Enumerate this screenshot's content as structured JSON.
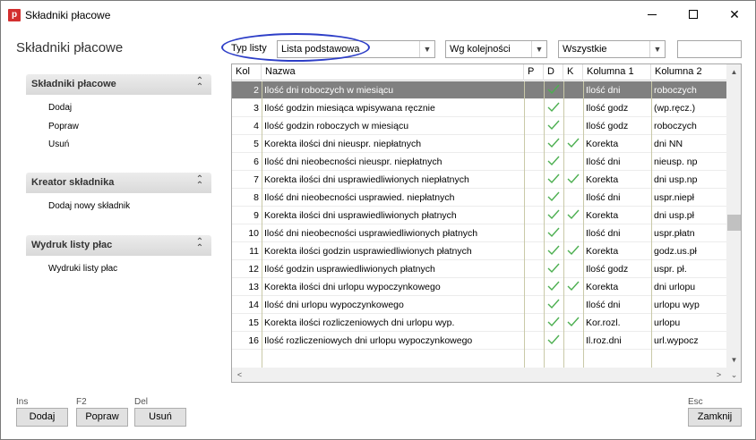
{
  "window": {
    "app_icon_letter": "p",
    "title": "Składniki płacowe"
  },
  "page_title": "Składniki płacowe",
  "sidebar": {
    "panels": [
      {
        "title": "Składniki płacowe",
        "links": [
          "Dodaj",
          "Popraw",
          "Usuń"
        ]
      },
      {
        "title": "Kreator składnika",
        "links": [
          "Dodaj nowy składnik"
        ]
      },
      {
        "title": "Wydruk listy płac",
        "links": [
          "Wydruki listy płac"
        ]
      }
    ]
  },
  "toolbar": {
    "list_type_label": "Typ listy",
    "list_type_value": "Lista podstawowa",
    "order_value": "Wg kolejności",
    "filter_value": "Wszystkie",
    "search_value": ""
  },
  "grid": {
    "columns": [
      "Kol",
      "Nazwa",
      "P",
      "D",
      "K",
      "Kolumna 1",
      "Kolumna 2"
    ],
    "rows": [
      {
        "kol": "2",
        "nazwa": "Ilość dni roboczych w miesiącu",
        "p": false,
        "d": true,
        "k": false,
        "k1": "Ilość dni",
        "k2": "roboczych",
        "selected": true
      },
      {
        "kol": "3",
        "nazwa": "Ilość godzin miesiąca wpisywana ręcznie",
        "p": false,
        "d": true,
        "k": false,
        "k1": "Ilość godz",
        "k2": "(wp.ręcz.)"
      },
      {
        "kol": "4",
        "nazwa": "Ilość godzin roboczych w miesiącu",
        "p": false,
        "d": true,
        "k": false,
        "k1": "Ilość godz",
        "k2": "roboczych"
      },
      {
        "kol": "5",
        "nazwa": "Korekta ilości dni nieuspr. niepłatnych",
        "p": false,
        "d": true,
        "k": true,
        "k1": "Korekta",
        "k2": "dni NN"
      },
      {
        "kol": "6",
        "nazwa": "Ilość dni nieobecności nieuspr. niepłatnych",
        "p": false,
        "d": true,
        "k": false,
        "k1": "Ilość dni",
        "k2": "nieusp. np"
      },
      {
        "kol": "7",
        "nazwa": "Korekta ilości dni usprawiedliwionych niepłatnych",
        "p": false,
        "d": true,
        "k": true,
        "k1": "Korekta",
        "k2": "dni usp.np"
      },
      {
        "kol": "8",
        "nazwa": "Ilość dni nieobecności usprawied. niepłatnych",
        "p": false,
        "d": true,
        "k": false,
        "k1": "Ilość dni",
        "k2": "uspr.niepł"
      },
      {
        "kol": "9",
        "nazwa": "Korekta ilości dni usprawiedliwionych płatnych",
        "p": false,
        "d": true,
        "k": true,
        "k1": "Korekta",
        "k2": "dni usp.pł"
      },
      {
        "kol": "10",
        "nazwa": "Ilość dni nieobecności usprawiedliwionych płatnych",
        "p": false,
        "d": true,
        "k": false,
        "k1": "Ilość dni",
        "k2": "uspr.płatn"
      },
      {
        "kol": "11",
        "nazwa": "Korekta ilości godzin usprawiedliwionych płatnych",
        "p": false,
        "d": true,
        "k": true,
        "k1": "Korekta",
        "k2": "godz.us.pł"
      },
      {
        "kol": "12",
        "nazwa": "Ilość godzin usprawiedliwionych płatnych",
        "p": false,
        "d": true,
        "k": false,
        "k1": "Ilość godz",
        "k2": "uspr. pł."
      },
      {
        "kol": "13",
        "nazwa": "Korekta ilości dni urlopu wypoczynkowego",
        "p": false,
        "d": true,
        "k": true,
        "k1": "Korekta",
        "k2": "dni urlopu"
      },
      {
        "kol": "14",
        "nazwa": "Ilość dni urlopu wypoczynkowego",
        "p": false,
        "d": true,
        "k": false,
        "k1": "Ilość dni",
        "k2": "urlopu wyp"
      },
      {
        "kol": "15",
        "nazwa": "Korekta ilości rozliczeniowych dni urlopu wyp.",
        "p": false,
        "d": true,
        "k": true,
        "k1": "Kor.rozl.",
        "k2": "urlopu"
      },
      {
        "kol": "16",
        "nazwa": "Ilość rozliczeniowych dni urlopu wypoczynkowego",
        "p": false,
        "d": true,
        "k": false,
        "k1": "Il.roz.dni",
        "k2": "url.wypocz"
      }
    ]
  },
  "footer": {
    "add": {
      "key": "Ins",
      "label": "Dodaj"
    },
    "edit": {
      "key": "F2",
      "label": "Popraw"
    },
    "delete": {
      "key": "Del",
      "label": "Usuń"
    },
    "close": {
      "key": "Esc",
      "label": "Zamknij"
    }
  },
  "colors": {
    "check": "#4caf50",
    "selected_row": "#808080",
    "highlight_oval": "#2d3ec7",
    "app_icon": "#d32f2f"
  }
}
